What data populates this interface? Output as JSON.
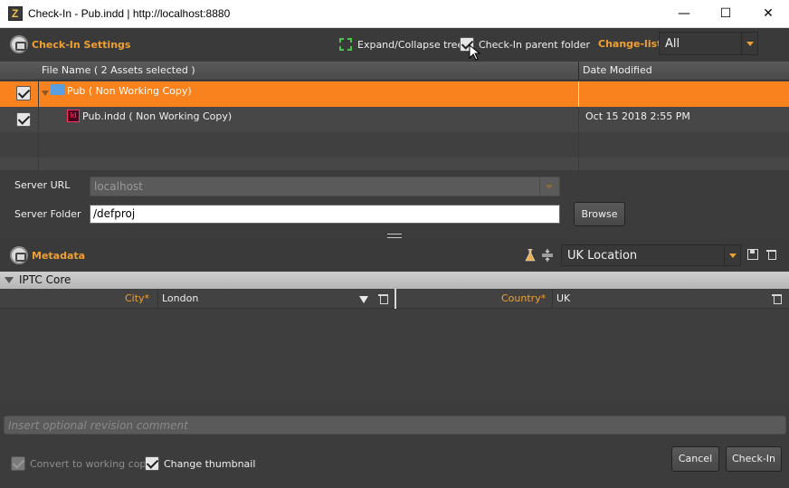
{
  "window": {
    "title": "Check-In - Pub.indd | http://localhost:8880",
    "app_icon_glyph": "Z",
    "minimize_glyph": "—",
    "maximize_glyph": "☐",
    "close_glyph": "✕"
  },
  "checkin_settings": {
    "title": "Check-In Settings",
    "expand_collapse_label": "Expand/Collapse tree",
    "checkin_parent_label": "Check-In parent folder",
    "checkin_parent_checked": true,
    "changelist_label": "Change-list:",
    "changelist_value": "All"
  },
  "table": {
    "columns": [
      "File Name ( 2 Assets selected )",
      "Date Modified"
    ],
    "rows": [
      {
        "name": "Pub ( Non Working Copy)",
        "date": "",
        "checked": true,
        "selected": true,
        "icon": "folder-icon"
      },
      {
        "name": "Pub.indd ( Non Working Copy)",
        "date": "Oct 15 2018 2:55 PM",
        "checked": true,
        "selected": false,
        "icon": "indesign-file-icon",
        "icon_text": "Id"
      }
    ]
  },
  "server": {
    "url_label": "Server URL",
    "url_value": "localhost",
    "folder_label": "Server Folder",
    "folder_value": "/defproj",
    "browse_label": "Browse"
  },
  "metadata": {
    "title": "Metadata",
    "preset_value": "UK Location",
    "group_title": "IPTC Core",
    "fields": [
      {
        "label": "City*",
        "value": "London"
      },
      {
        "label": "Country*",
        "value": "UK"
      }
    ]
  },
  "footer": {
    "comment_placeholder": "Insert optional revision comment",
    "convert_label": "Convert to working copy",
    "convert_checked": true,
    "thumbnail_label": "Change thumbnail",
    "thumbnail_checked": true,
    "cancel_label": "Cancel",
    "checkin_label": "Check-In"
  },
  "colors": {
    "accent": "#f0a030",
    "selected_row": "#f7821e",
    "panel": "#3c3c3c"
  }
}
